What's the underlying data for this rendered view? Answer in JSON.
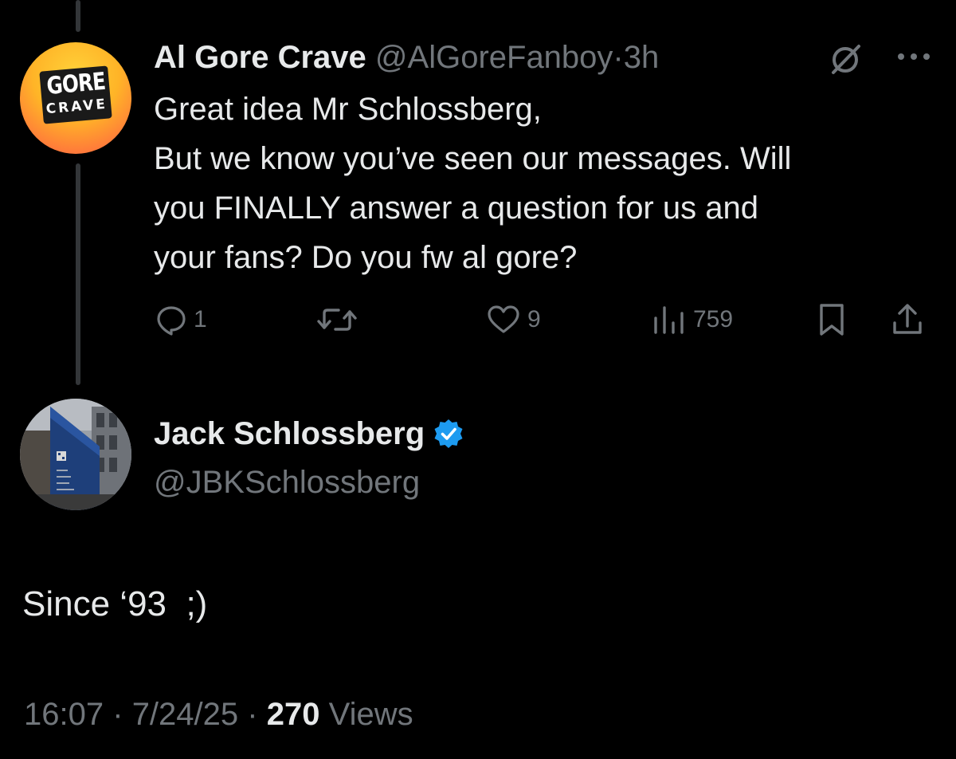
{
  "tweet": {
    "author": {
      "name": "Al Gore Crave",
      "handle": "@AlGoreFanboy",
      "avatar_line1": "GORE",
      "avatar_line2": "CRAVE"
    },
    "separator": "·",
    "time": "3h",
    "text_lines": [
      "Great idea Mr Schlossberg,",
      "But we know you’ve seen our messages. Will",
      "you FINALLY answer a question for us and",
      "your fans?  Do you fw al gore?"
    ],
    "actions": {
      "reply_count": "1",
      "retweet_count": "",
      "like_count": "9",
      "views_count": "759"
    },
    "icons": [
      "grok-icon",
      "more-icon",
      "reply-icon",
      "retweet-icon",
      "like-icon",
      "views-icon",
      "bookmark-icon",
      "share-icon"
    ]
  },
  "reply": {
    "author": {
      "name": "Jack Schlossberg",
      "handle": "@JBKSchlossberg",
      "verified": true
    },
    "text": "Since ‘93  ;)",
    "meta": {
      "time": "16:07",
      "separator1": "·",
      "date": "7/24/25",
      "separator2": "·",
      "views_count": "270",
      "views_label": "Views"
    }
  },
  "colors": {
    "background": "#000000",
    "text_primary": "#e7e9ea",
    "text_secondary": "#71767b",
    "verified_blue": "#1d9bf0",
    "thread_line": "#333639"
  }
}
